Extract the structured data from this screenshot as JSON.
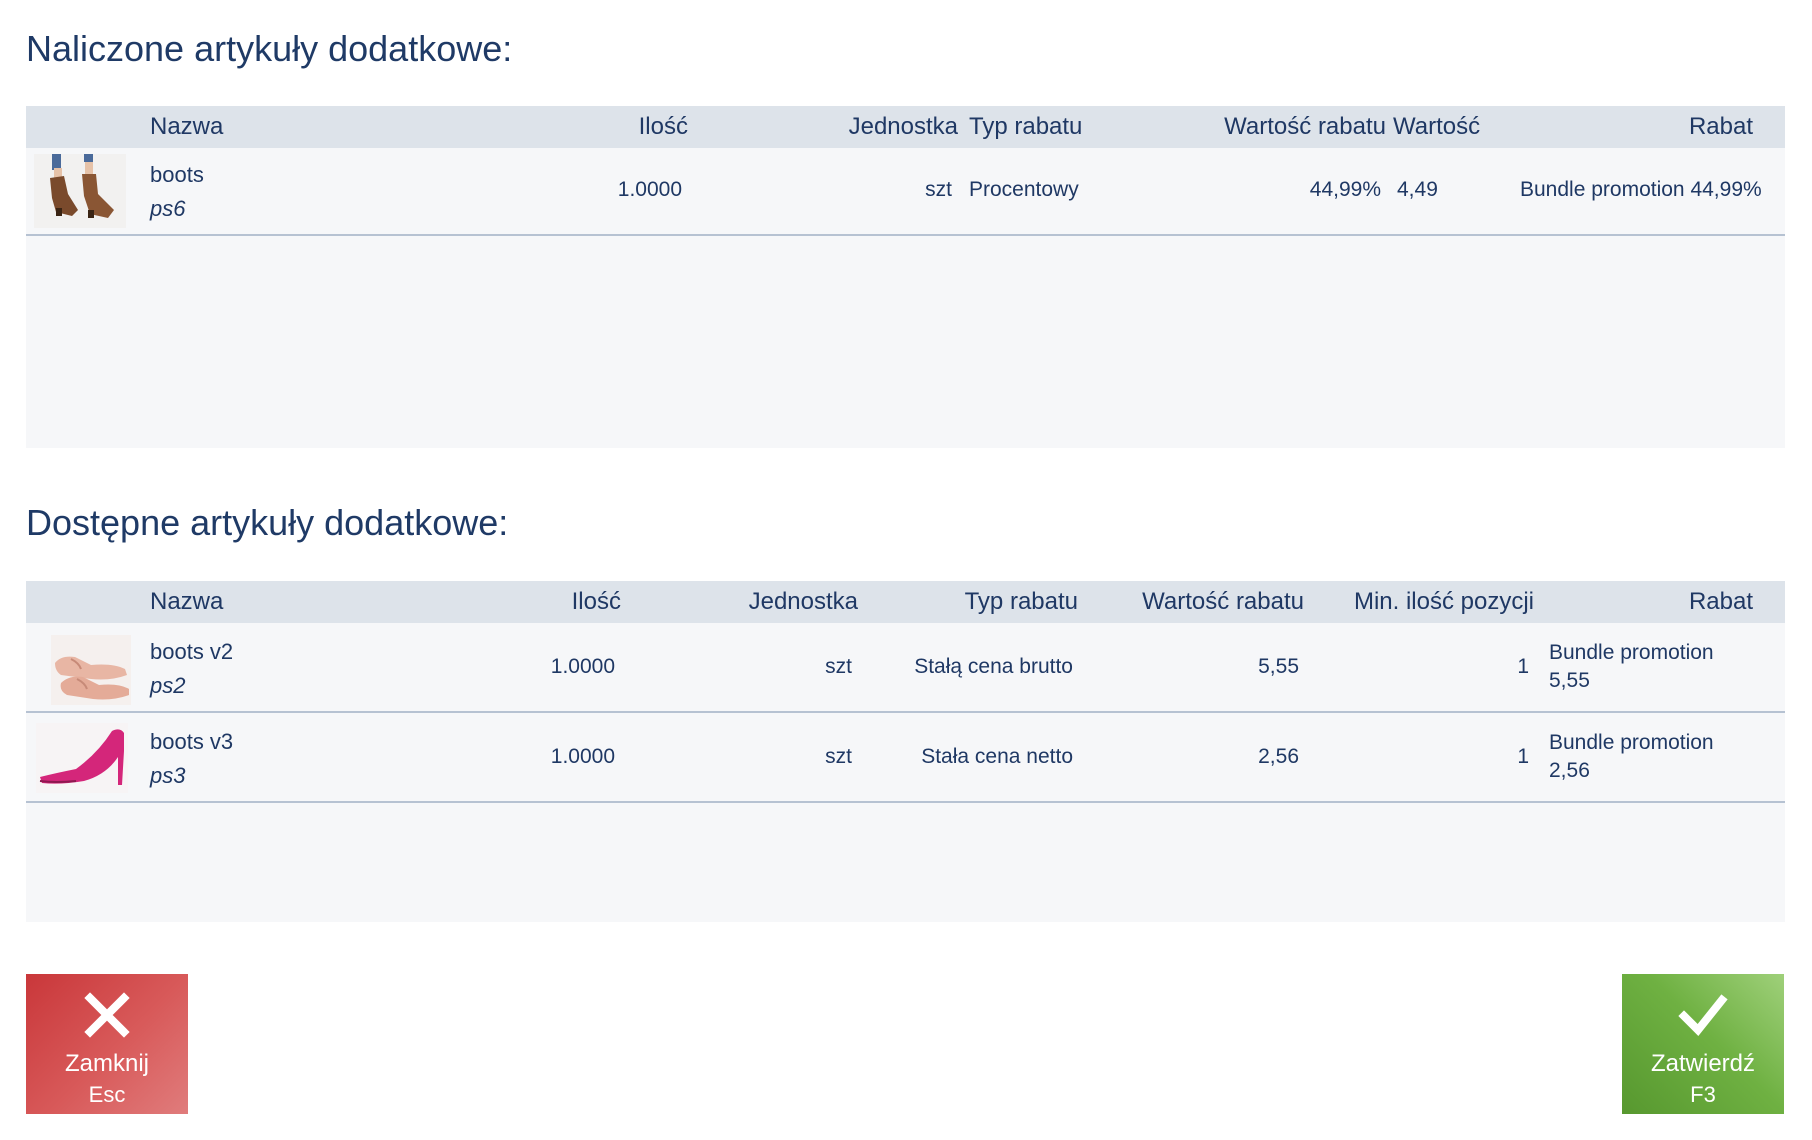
{
  "charged": {
    "title": "Naliczone artykuły dodatkowe:",
    "columns": [
      "Nazwa",
      "Ilość",
      "Jednostka",
      "Typ rabatu",
      "Wartość rabatu",
      "Wartość",
      "Rabat"
    ],
    "rows": [
      {
        "name": "boots",
        "code": "ps6",
        "qty": "1.0000",
        "unit": "szt",
        "discount_type": "Procentowy",
        "discount_value": "44,99%",
        "value": "4,49",
        "discount": "Bundle promotion 44,99%",
        "image": "brown-ankle-boots"
      }
    ]
  },
  "available": {
    "title": "Dostępne artykuły dodatkowe:",
    "columns": [
      "Nazwa",
      "Ilość",
      "Jednostka",
      "Typ rabatu",
      "Wartość rabatu",
      "Min. ilość pozycji",
      "Rabat"
    ],
    "rows": [
      {
        "name": "boots v2",
        "code": "ps2",
        "qty": "1.0000",
        "unit": "szt",
        "discount_type": "Stałą cena brutto",
        "discount_value": "5,55",
        "min_qty": "1",
        "discount_line1": "Bundle promotion",
        "discount_line2": "5,55",
        "image": "pink-flat-shoes"
      },
      {
        "name": "boots v3",
        "code": "ps3",
        "qty": "1.0000",
        "unit": "szt",
        "discount_type": "Stała cena netto",
        "discount_value": "2,56",
        "min_qty": "1",
        "discount_line1": "Bundle promotion",
        "discount_line2": "2,56",
        "image": "magenta-heel-pump"
      }
    ]
  },
  "buttons": {
    "close_label": "Zamknij",
    "close_key": "Esc",
    "confirm_label": "Zatwierdź",
    "confirm_key": "F3"
  },
  "colors": {
    "close": "#d04a4b",
    "confirm": "#6fb142",
    "header": "#dde3ea",
    "text": "#1f3864"
  }
}
